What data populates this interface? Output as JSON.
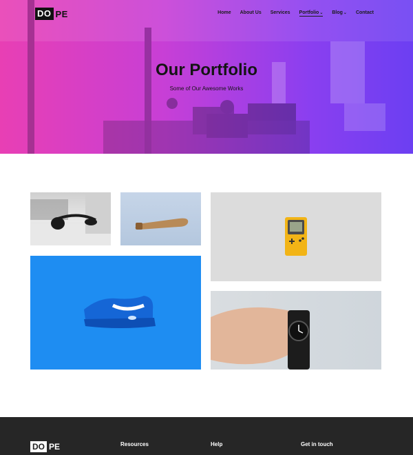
{
  "brand": {
    "logo_box": "DO",
    "logo_rest": "PE"
  },
  "nav": {
    "items": [
      {
        "label": "Home"
      },
      {
        "label": "About Us"
      },
      {
        "label": "Services"
      },
      {
        "label": "Portfolio",
        "dropdown": true
      },
      {
        "label": "Blog",
        "dropdown": true
      },
      {
        "label": "Contact"
      }
    ],
    "caret": "⌄"
  },
  "hero": {
    "title": "Our Portfolio",
    "subtitle": "Some of Our Awesome Works",
    "gradient_colors": [
      "#e83fb4",
      "#6c3ff2"
    ]
  },
  "portfolio": {
    "items": [
      {
        "subject": "headphones"
      },
      {
        "subject": "wooden-object"
      },
      {
        "subject": "yellow-gameboy"
      },
      {
        "subject": "blue-sneaker"
      },
      {
        "subject": "hand-with-watch"
      }
    ]
  },
  "footer": {
    "logo_box": "DO",
    "logo_rest": "PE",
    "headings": [
      "Resources",
      "Help",
      "Get in touch"
    ]
  }
}
